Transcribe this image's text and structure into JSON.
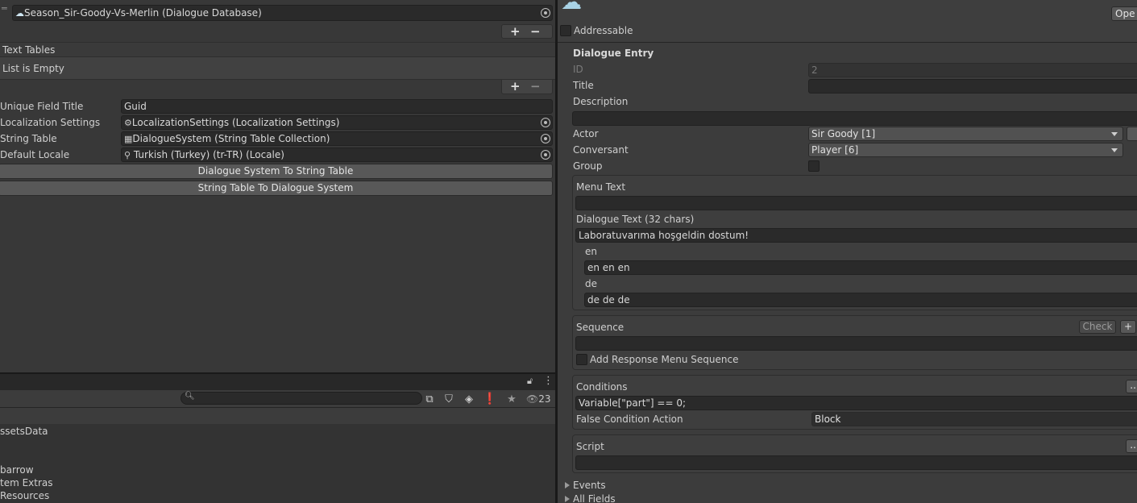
{
  "left": {
    "database_field": "Season_Sir-Goody-Vs-Merlin (Dialogue Database)",
    "add_symbol": "+",
    "remove_symbol": "−",
    "text_tables_header": "Text Tables",
    "list_empty": "List is Empty",
    "rows": [
      {
        "label": "Unique Field Title",
        "value": "Guid"
      },
      {
        "label": "Localization Settings",
        "value": "LocalizationSettings (Localization Settings)"
      },
      {
        "label": "String Table",
        "value": "DialogueSystem (String Table Collection)"
      },
      {
        "label": "Default Locale",
        "value": "Turkish (Turkey) (tr-TR) (Locale)"
      }
    ],
    "btn_to_string_table": "Dialogue System To String Table",
    "btn_to_dialogue_system": "String Table To Dialogue System"
  },
  "project": {
    "hidden_count": "23",
    "items": [
      "ssetsData",
      "barrow",
      "tem Extras",
      " Resources"
    ]
  },
  "inspector": {
    "open_button": "Ope",
    "addressable": "Addressable",
    "section_title": "Dialogue Entry",
    "id_label": "ID",
    "id_value": "2",
    "title_label": "Title",
    "title_value": "",
    "description_label": "Description",
    "actor_label": "Actor",
    "actor_value": "Sir Goody [1]",
    "conversant_label": "Conversant",
    "conversant_value": "Player [6]",
    "group_label": "Group",
    "menu_text_label": "Menu Text",
    "dialogue_text_label": "Dialogue Text (32 chars)",
    "dialogue_text_value": "Laboratuvarıma hoşgeldin dostum!",
    "lang_en_label": "en",
    "lang_en_value": "en en en",
    "lang_de_label": "de",
    "lang_de_value": "de de de",
    "sequence_label": "Sequence",
    "check_button": "Check",
    "plus_button": "+",
    "add_response_label": "Add Response Menu Sequence",
    "conditions_label": "Conditions",
    "conditions_value": "Variable[\"part\"] == 0;",
    "false_action_label": "False Condition Action",
    "false_action_value": "Block",
    "script_label": "Script",
    "ellipsis": "...",
    "events_label": "Events",
    "all_fields_label": "All Fields"
  }
}
